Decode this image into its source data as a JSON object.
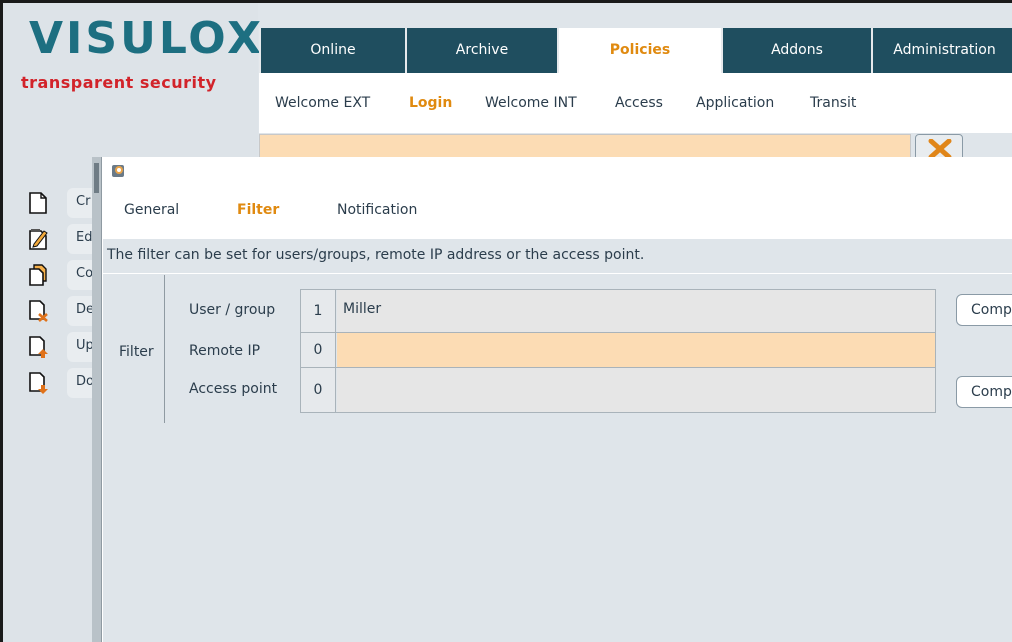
{
  "brand": {
    "logo": "VISULOX",
    "tagline": "transparent security",
    "logo_color": "#1d6f81",
    "tagline_color": "#d2232a"
  },
  "top_tabs": [
    {
      "label": "Online",
      "active": false
    },
    {
      "label": "Archive",
      "active": false
    },
    {
      "label": "Policies",
      "active": true
    },
    {
      "label": "Addons",
      "active": false
    },
    {
      "label": "Administration",
      "active": false
    }
  ],
  "sub_tabs": [
    {
      "label": "Welcome EXT",
      "active": false
    },
    {
      "label": "Login",
      "active": true
    },
    {
      "label": "Welcome INT",
      "active": false
    },
    {
      "label": "Access",
      "active": false
    },
    {
      "label": "Application",
      "active": false
    },
    {
      "label": "Transit",
      "active": false
    }
  ],
  "sidebar": {
    "items": [
      {
        "label": "Cr",
        "icon": "document-icon"
      },
      {
        "label": "Ed",
        "icon": "edit-document-icon"
      },
      {
        "label": "Co",
        "icon": "copy-document-icon"
      },
      {
        "label": "De",
        "icon": "delete-document-icon"
      },
      {
        "label": "Up",
        "icon": "upload-document-icon"
      },
      {
        "label": "Do",
        "icon": "download-document-icon"
      }
    ]
  },
  "dialog": {
    "icon": "app-icon",
    "tabs": [
      {
        "label": "General",
        "active": false
      },
      {
        "label": "Filter",
        "active": true
      },
      {
        "label": "Notification",
        "active": false
      }
    ],
    "info": "The filter can be set for users/groups, remote IP address or the access point.",
    "section_label": "Filter",
    "rows": [
      {
        "label": "User / group",
        "count": "1",
        "value": "Miller",
        "button": "Comp"
      },
      {
        "label": "Remote IP",
        "count": "0",
        "value": "",
        "button": ""
      },
      {
        "label": "Access point",
        "count": "0",
        "value": "",
        "button": "Comp"
      }
    ]
  },
  "colors": {
    "accent": "#e08a10",
    "tab_dark": "#1f4e5f",
    "highlight": "#fcdcb4",
    "panel": "#dfe5ea"
  }
}
